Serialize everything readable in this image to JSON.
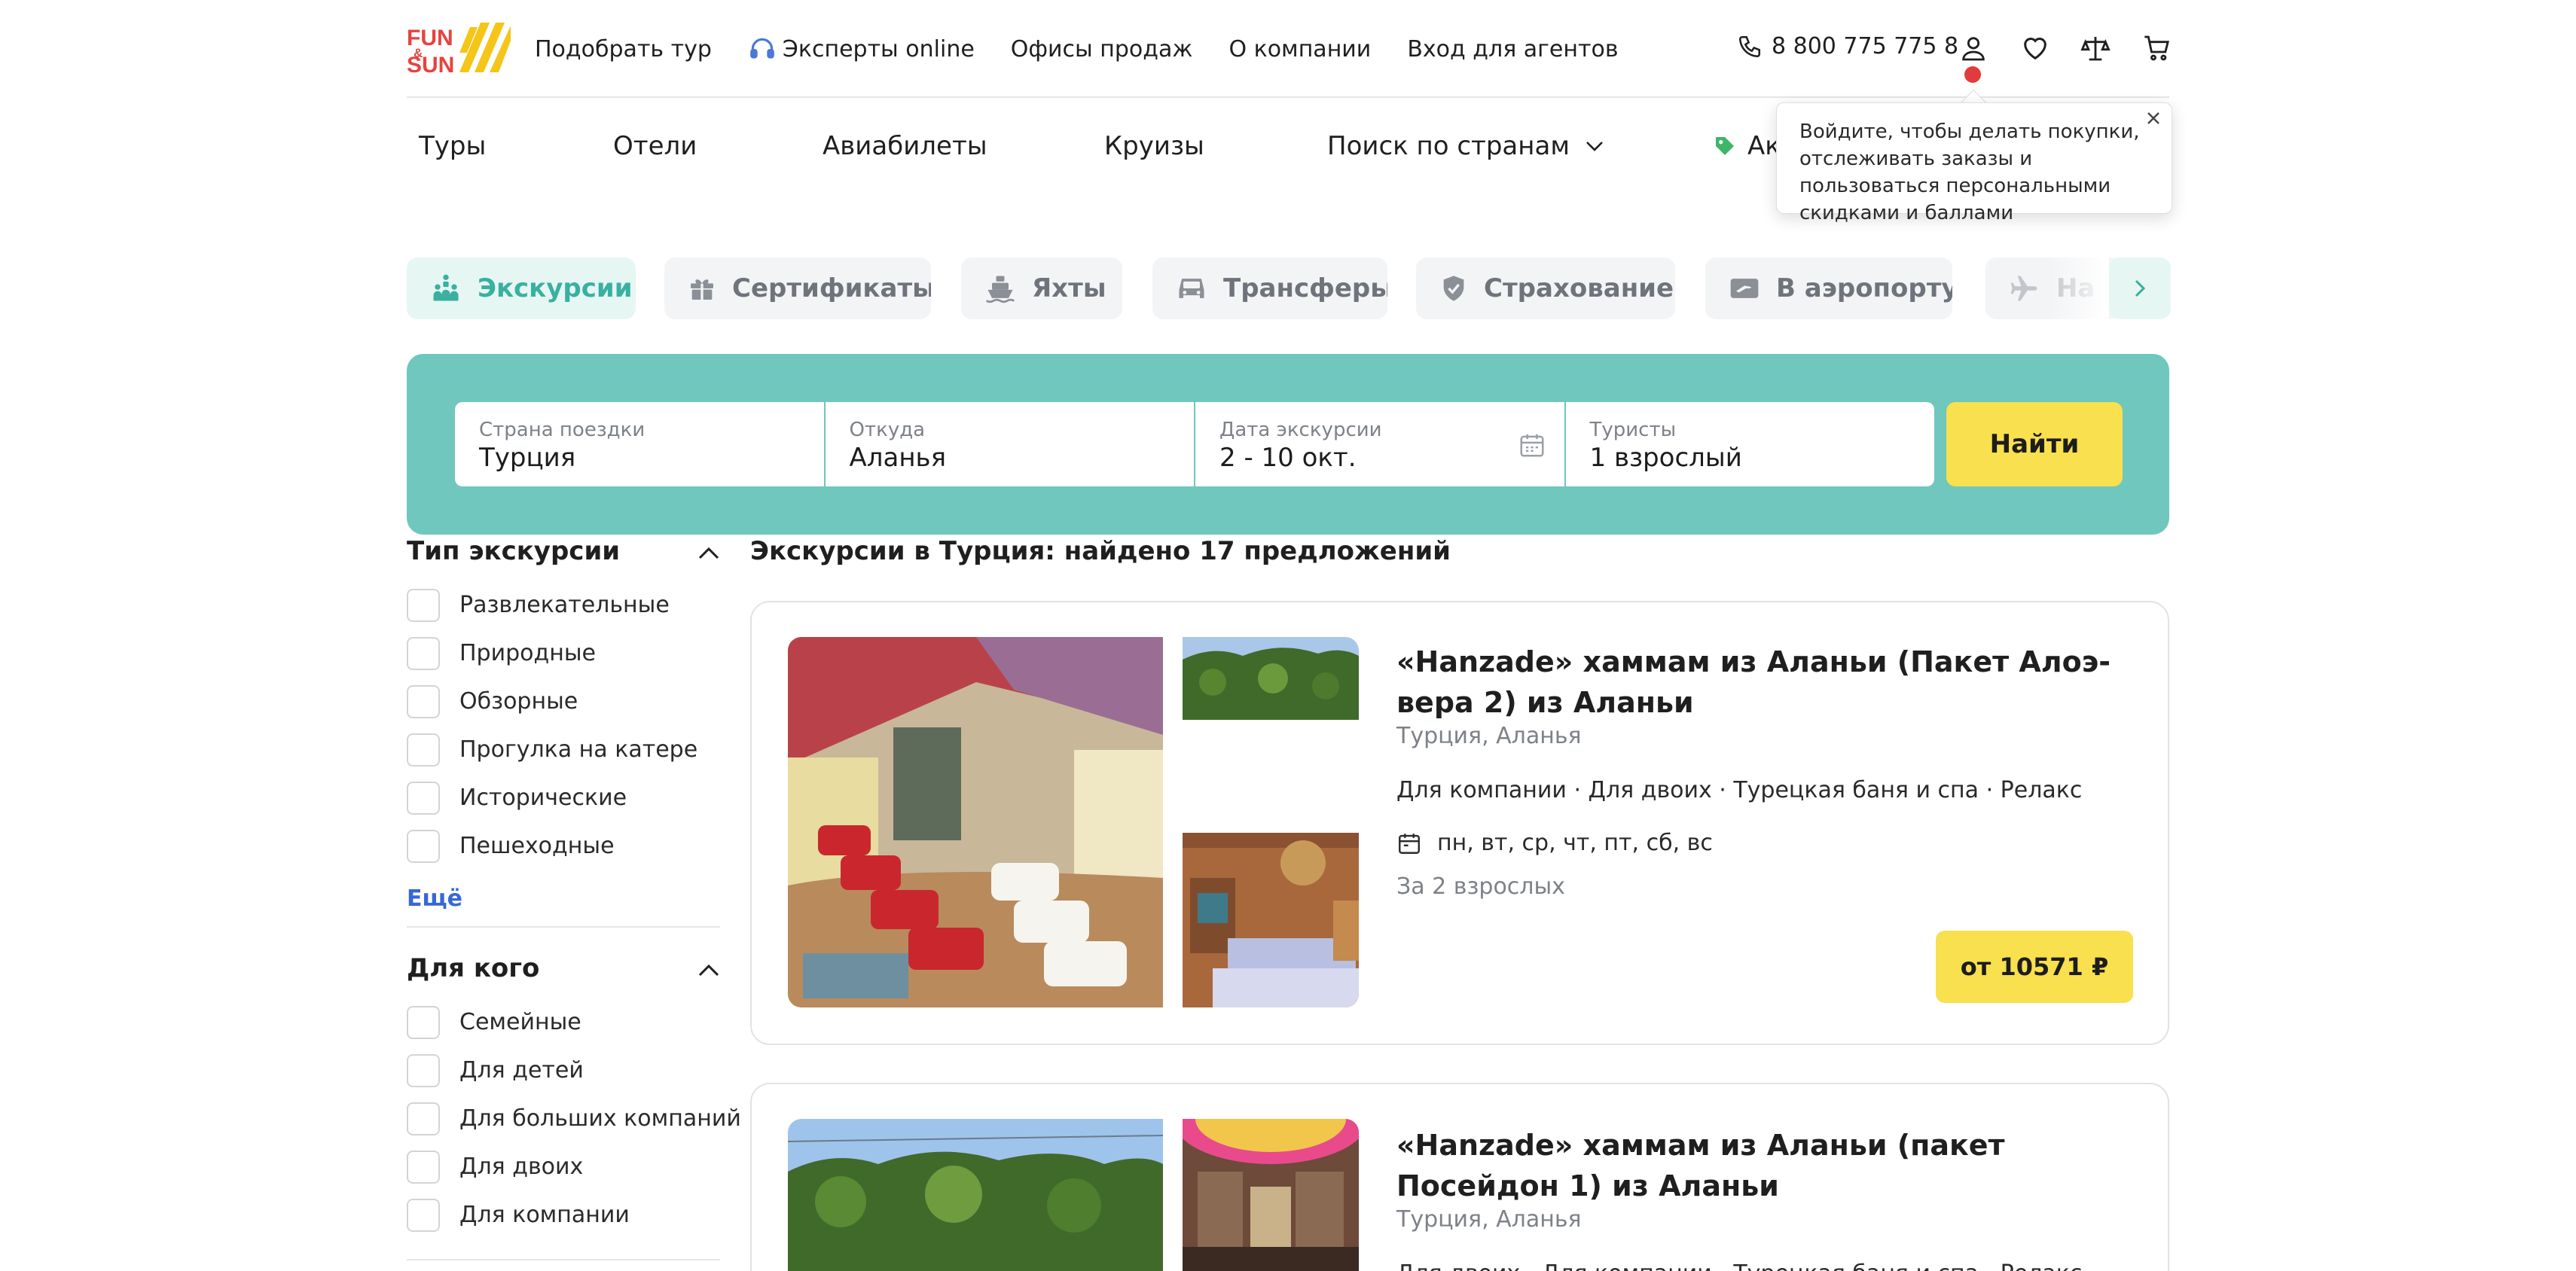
{
  "header": {
    "logo_text": "FUN & SUN",
    "nav": [
      "Подобрать тур",
      "Эксперты online",
      "Офисы продаж",
      "О компании",
      "Вход для агентов"
    ],
    "phone": "8 800 775 775 8"
  },
  "subnav": {
    "items": [
      "Туры",
      "Отели",
      "Авиабилеты",
      "Круизы",
      "Поиск по странам",
      "Ак"
    ]
  },
  "tooltip": {
    "text": "Войдите, чтобы делать покупки, отслеживать заказы и пользоваться персональными скидками и баллами"
  },
  "categories": {
    "active_index": 0,
    "items": [
      "Экскурсии",
      "Сертификаты",
      "Яхты",
      "Трансферы",
      "Страхование",
      "В аэропорту",
      "На"
    ]
  },
  "search": {
    "country_label": "Страна поездки",
    "country_value": "Турция",
    "from_label": "Откуда",
    "from_value": "Аланья",
    "date_label": "Дата экскурсии",
    "date_value": "2 - 10 окт.",
    "tourists_label": "Туристы",
    "tourists_value": "1 взрослый",
    "find_label": "Найти"
  },
  "filters": {
    "type": {
      "title": "Тип экскурсии",
      "options": [
        "Развлекательные",
        "Природные",
        "Обзорные",
        "Прогулка на катере",
        "Исторические",
        "Пешеходные"
      ],
      "more": "Ещё"
    },
    "for_whom": {
      "title": "Для кого",
      "options": [
        "Семейные",
        "Для детей",
        "Для больших компаний",
        "Для двоих",
        "Для компании"
      ]
    }
  },
  "results": {
    "title": "Экскурсии в Турция: найдено 17 предложений",
    "cards": [
      {
        "title": "«Hanzade» хаммам из Аланьи (Пакет Алоэ-вера 2) из Аланьи",
        "location": "Турция, Аланья",
        "tags": "Для компании · Для двоих · Турецкая баня и спа · Релакс",
        "days": "пн, вт, ср, чт, пт, сб, вс",
        "note": "За 2 взрослых",
        "price": "от 10571 ₽"
      },
      {
        "title": "«Hanzade» хаммам из Аланьи (пакет Посейдон 1) из Аланьи",
        "location": "Турция, Аланья",
        "tags": "Для двоих · Для компании · Турецкая баня и спа · Релакс"
      }
    ]
  },
  "colors": {
    "accent_teal": "#6fc7bd",
    "accent_yellow": "#f8e04e",
    "logo_red": "#e8423f",
    "logo_yellow": "#f5c518",
    "link_blue": "#3567d6"
  }
}
